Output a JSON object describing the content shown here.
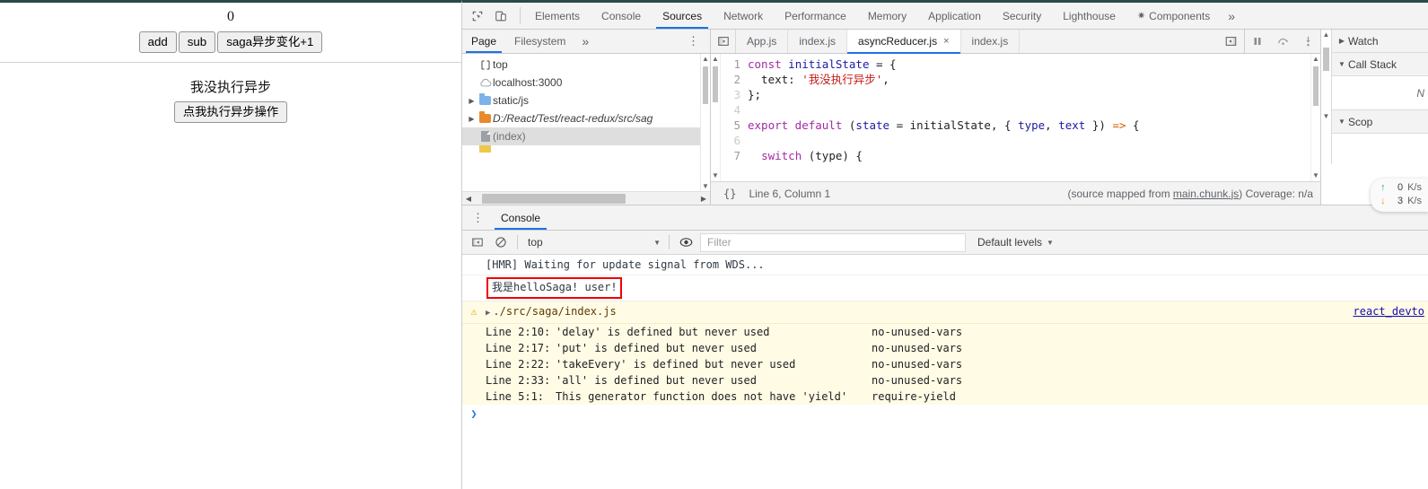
{
  "page": {
    "counter_value": "0",
    "buttons": [
      {
        "label": "add",
        "name": "add-button"
      },
      {
        "label": "sub",
        "name": "sub-button"
      },
      {
        "label": "saga异步变化+1",
        "name": "saga-async-increment-button"
      }
    ],
    "async_status_text": "我没执行异步",
    "async_action_button": "点我执行异步操作"
  },
  "devtools": {
    "main_tabs": [
      {
        "label": "Elements",
        "active": false
      },
      {
        "label": "Console",
        "active": false
      },
      {
        "label": "Sources",
        "active": true
      },
      {
        "label": "Network",
        "active": false
      },
      {
        "label": "Performance",
        "active": false
      },
      {
        "label": "Memory",
        "active": false
      },
      {
        "label": "Application",
        "active": false
      },
      {
        "label": "Security",
        "active": false
      },
      {
        "label": "Lighthouse",
        "active": false
      },
      {
        "label": "Components",
        "active": false,
        "icon": "react-gear-icon"
      }
    ],
    "more_tabs_label": "»",
    "inspect_icon": "inspect-element-icon",
    "device_toolbar_icon": "device-toolbar-icon",
    "navigator": {
      "tabs": [
        {
          "label": "Page",
          "active": true
        },
        {
          "label": "Filesystem",
          "active": false
        }
      ],
      "more_label": "»",
      "kebab_label": "⋮",
      "tree": [
        {
          "label": "top",
          "icon": "frame-icon",
          "twisty": "",
          "indent": 0,
          "selected": false,
          "italic": false
        },
        {
          "label": "localhost:3000",
          "icon": "cloud-icon",
          "twisty": "",
          "indent": 1,
          "selected": false,
          "italic": false
        },
        {
          "label": "static/js",
          "icon": "folder-blue-icon",
          "twisty": "▶",
          "indent": 1,
          "selected": false,
          "italic": false
        },
        {
          "label": "D:/React/Test/react-redux/src/sag",
          "icon": "folder-orange-icon",
          "twisty": "▶",
          "indent": 1,
          "selected": false,
          "italic": true
        },
        {
          "label": "(index)",
          "icon": "document-icon",
          "twisty": "",
          "indent": 2,
          "selected": true,
          "italic": false
        },
        {
          "label": "",
          "icon": "folder-yellow-icon",
          "twisty": "",
          "indent": 1,
          "selected": false,
          "italic": false
        }
      ]
    },
    "editor": {
      "prev_panel_icon": "show-navigator-icon",
      "tabs": [
        {
          "label": "App.js",
          "active": false,
          "closable": false
        },
        {
          "label": "index.js",
          "active": false,
          "closable": false
        },
        {
          "label": "asyncReducer.js",
          "active": true,
          "closable": true
        },
        {
          "label": "index.js",
          "active": false,
          "closable": false
        }
      ],
      "close_glyph": "×",
      "show_debugger_icon": "show-debugger-sidebar-icon",
      "debug_buttons": [
        {
          "name": "pause-script-button",
          "glyph": "pause-icon"
        },
        {
          "name": "step-over-button",
          "glyph": "step-over-icon"
        },
        {
          "name": "step-into-button",
          "glyph": "step-into-icon"
        }
      ],
      "code_lines": [
        {
          "num": "1",
          "tokens": [
            {
              "t": "const",
              "c": "k-kw"
            },
            {
              "t": " ",
              "c": ""
            },
            {
              "t": "initialState",
              "c": "k-var"
            },
            {
              "t": " = {",
              "c": ""
            }
          ]
        },
        {
          "num": "2",
          "tokens": [
            {
              "t": "  text: ",
              "c": ""
            },
            {
              "t": "'我没执行异步'",
              "c": "k-str"
            },
            {
              "t": ",",
              "c": ""
            }
          ]
        },
        {
          "num": "3",
          "tokens": [
            {
              "t": "};",
              "c": ""
            }
          ]
        },
        {
          "num": "4",
          "tokens": [
            {
              "t": "",
              "c": ""
            }
          ]
        },
        {
          "num": "5",
          "tokens": [
            {
              "t": "export default ",
              "c": "k-kw"
            },
            {
              "t": "(",
              "c": ""
            },
            {
              "t": "state",
              "c": "k-var"
            },
            {
              "t": " = initialState, { ",
              "c": ""
            },
            {
              "t": "type",
              "c": "k-var"
            },
            {
              "t": ", ",
              "c": ""
            },
            {
              "t": "text",
              "c": "k-var"
            },
            {
              "t": " }) ",
              "c": ""
            },
            {
              "t": "=>",
              "c": "k-op"
            },
            {
              "t": " {",
              "c": ""
            }
          ]
        },
        {
          "num": "6",
          "tokens": [
            {
              "t": "",
              "c": ""
            }
          ]
        },
        {
          "num": "7",
          "tokens": [
            {
              "t": "  ",
              "c": ""
            },
            {
              "t": "switch",
              "c": "k-kw"
            },
            {
              "t": " (type) {",
              "c": ""
            }
          ]
        }
      ],
      "dim_line_numbers": [
        "3",
        "4",
        "6"
      ],
      "status": {
        "format_icon": "{}",
        "position": "Line 6, Column 1",
        "source_map_prefix": "(source mapped from ",
        "source_map_link": "main.chunk.js",
        "source_map_suffix": ") Coverage: n/a"
      }
    },
    "debug_sidebar": {
      "sections": [
        {
          "label": "Watch",
          "caret": "▶",
          "expanded": false
        },
        {
          "label": "Call Stack",
          "caret": "▼",
          "expanded": true
        },
        {
          "label": "Scop",
          "caret": "▼",
          "expanded": true
        }
      ],
      "call_stack_text": "N"
    },
    "network_speed": {
      "up_value": "0",
      "up_unit": "K/s",
      "down_value": "3",
      "down_unit": "K/s"
    },
    "drawer": {
      "kebab_label": "⋮",
      "tab_label": "Console",
      "toolbar": {
        "sidebar_icon": "console-sidebar-icon",
        "clear_icon": "clear-console-icon",
        "context": "top",
        "eye_icon": "live-expression-icon",
        "filter_placeholder": "Filter",
        "levels_label": "Default levels"
      },
      "messages": [
        {
          "type": "log",
          "text": "[HMR] Waiting for update signal from WDS...",
          "highlighted": false
        },
        {
          "type": "log",
          "text": "我是helloSaga! user!",
          "highlighted": true
        }
      ],
      "warning": {
        "icon": "warning-icon",
        "disclosure": "▶",
        "title": "./src/saga/index.js",
        "source_link": "react_devto",
        "details": [
          {
            "line": "Line 2:10:",
            "message": "'delay' is defined but never used",
            "rule": "no-unused-vars"
          },
          {
            "line": "Line 2:17:",
            "message": "'put' is defined but never used",
            "rule": "no-unused-vars"
          },
          {
            "line": "Line 2:22:",
            "message": "'takeEvery' is defined but never used",
            "rule": "no-unused-vars"
          },
          {
            "line": "Line 2:33:",
            "message": "'all' is defined but never used",
            "rule": "no-unused-vars"
          },
          {
            "line": "Line 5:1:",
            "message": "This generator function does not have 'yield'",
            "rule": "require-yield"
          }
        ]
      },
      "prompt_caret": "❯"
    }
  },
  "colors": {
    "accent": "#1a73e8",
    "warn_bg": "#fffbe5",
    "highlight_border": "#f00000",
    "folder_blue": "#7cb3e8",
    "folder_orange": "#e8892b",
    "folder_yellow": "#ecc94b"
  }
}
